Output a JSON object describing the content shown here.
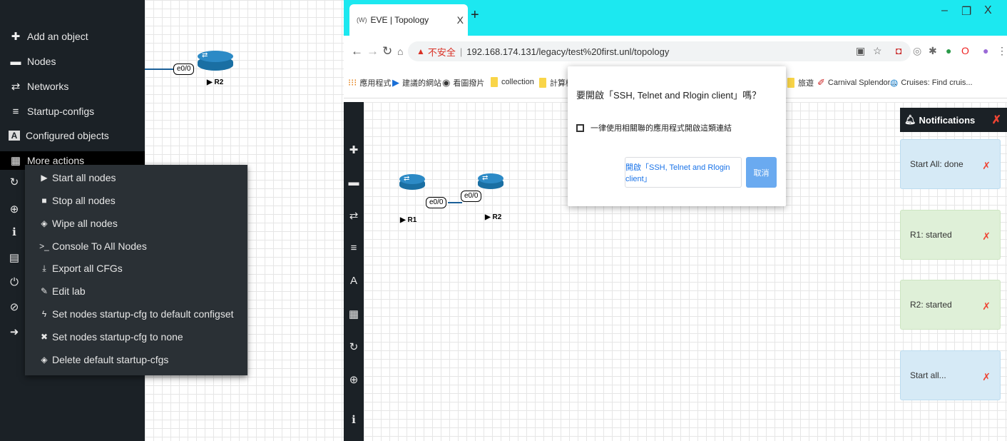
{
  "left_sidebar": {
    "items": [
      {
        "label": "Add an object",
        "icon": "plus-icon"
      },
      {
        "label": "Nodes",
        "icon": "laptop-icon"
      },
      {
        "label": "Networks",
        "icon": "exchange-icon"
      },
      {
        "label": "Startup-configs",
        "icon": "align-left-icon"
      },
      {
        "label": "Configured objects",
        "icon": "font-icon"
      },
      {
        "label": "More actions",
        "icon": "th-icon"
      }
    ]
  },
  "more_menu": {
    "items": [
      {
        "label": "Start all nodes",
        "icon": "play-icon"
      },
      {
        "label": "Stop all nodes",
        "icon": "stop-icon"
      },
      {
        "label": "Wipe all nodes",
        "icon": "eraser-icon"
      },
      {
        "label": "Console To All Nodes",
        "icon": "terminal-icon"
      },
      {
        "label": "Export all CFGs",
        "icon": "download-icon"
      },
      {
        "label": "Edit lab",
        "icon": "pencil-icon"
      },
      {
        "label": "Set nodes startup-cfg to default configset",
        "icon": "bolt-icon"
      },
      {
        "label": "Set nodes startup-cfg to none",
        "icon": "times-icon"
      },
      {
        "label": "Delete default startup-cfgs",
        "icon": "eraser-icon"
      }
    ]
  },
  "left_topology": {
    "iface": "e0/0",
    "node": "R2"
  },
  "browser": {
    "tab_title": "EVE | Topology",
    "tab_favicon": "(W)",
    "insecure_label": "不安全",
    "url": "192.168.174.131/legacy/test%20first.unl/topology",
    "bookmarks": [
      "應用程式",
      "建議的網站",
      "看圖撥片",
      "collection",
      "計算機網",
      "旅遊",
      "Carnival Splendor...",
      "Cruises: Find cruis..."
    ]
  },
  "topology": {
    "r1_label": "R1",
    "r2_label": "R2",
    "r1_iface": "e0/0",
    "r2_iface": "e0/0"
  },
  "dialog": {
    "title": "要開啟「SSH, Telnet and Rlogin client」嗎？",
    "checkbox_label": "一律使用相關聯的應用程式開啟這類連結",
    "open_label": "開啟「SSH, Telnet and Rlogin client」",
    "cancel_label": "取消"
  },
  "notifications": {
    "title": "Notifications",
    "items": [
      {
        "text": "Start All: done",
        "status": "info"
      },
      {
        "text": "R1: started",
        "status": "ok"
      },
      {
        "text": "R2: started",
        "status": "ok"
      },
      {
        "text": "Start all...",
        "status": "info"
      }
    ]
  },
  "colors": {
    "sidebar": "#1b2126",
    "tabbar": "#1ce8f0",
    "close_red": "#ee4433"
  }
}
